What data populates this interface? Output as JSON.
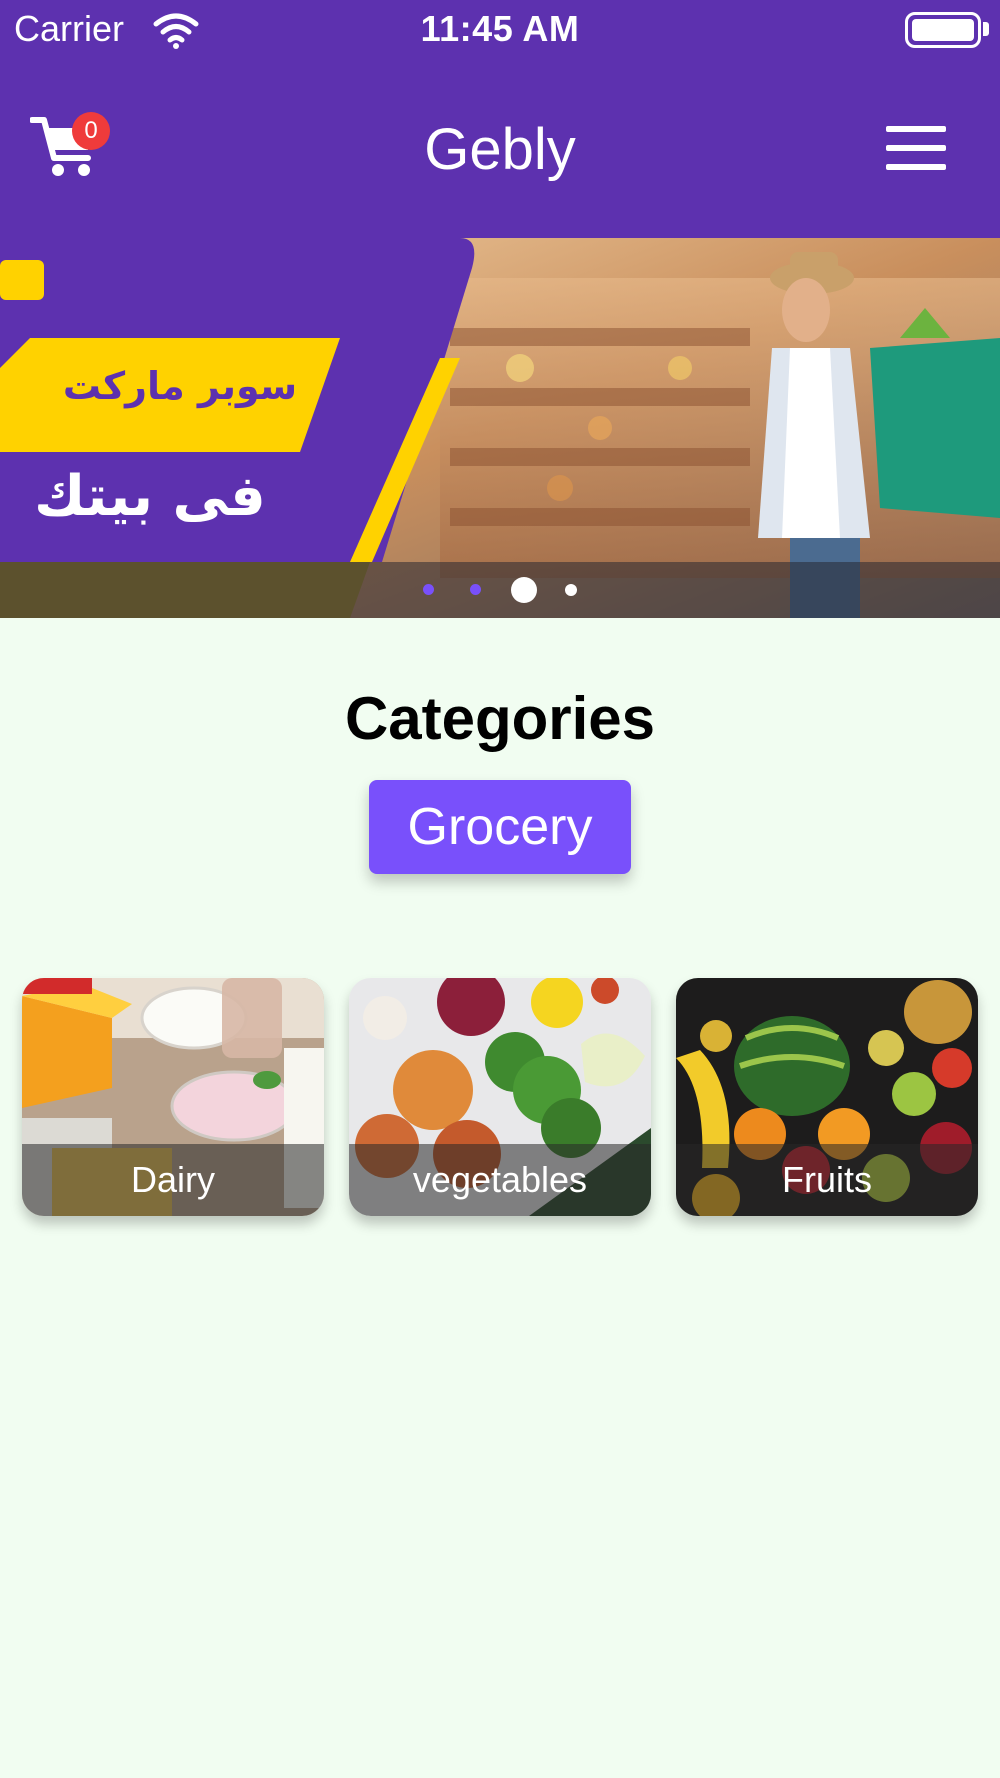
{
  "status_bar": {
    "carrier": "Carrier",
    "time": "11:45 AM"
  },
  "navbar": {
    "title": "Gebly",
    "cart_count": "0",
    "cart_icon": "cart-icon",
    "menu_icon": "hamburger-menu-icon"
  },
  "banner": {
    "headline_top": "سوبر ماركت",
    "headline_bottom": "فى بيتك",
    "slide_count": 4,
    "active_slide": 3
  },
  "categories": {
    "title": "Categories",
    "tabs": [
      {
        "label": "Grocery"
      }
    ],
    "items": [
      {
        "label": "Dairy"
      },
      {
        "label": "vegetables"
      },
      {
        "label": "Fruits"
      }
    ]
  },
  "colors": {
    "header": "#5d31af",
    "accent": "#7950fb",
    "banner_yellow": "#ffd200",
    "badge": "#ef3b3b",
    "background": "#f1fdf1"
  }
}
